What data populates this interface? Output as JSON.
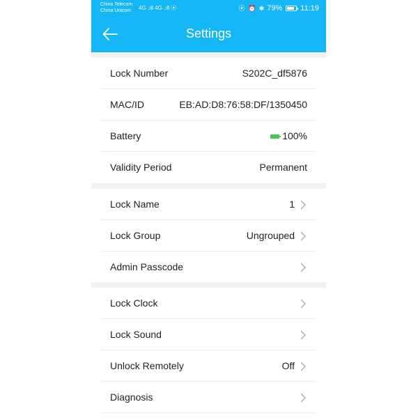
{
  "statusbar": {
    "carrier1": "China Telecom",
    "carrier2": "China Unicom",
    "signal_text": "4G .ıll 4G .ıll ⦿",
    "icons_text": "⦿ ⏰ ✱",
    "battery_percent": "79%",
    "time": "11:19"
  },
  "header": {
    "title": "Settings",
    "back_icon": "arrow-left-icon",
    "bg_color": "#14b6f5"
  },
  "info": [
    {
      "label": "Lock Number",
      "value": "S202C_df5876"
    },
    {
      "label": "MAC/ID",
      "value": "EB:AD:D8:76:58:DF/1350450"
    },
    {
      "label": "Battery",
      "value": "100%"
    },
    {
      "label": "Validity Period",
      "value": "Permanent"
    }
  ],
  "settings_a": [
    {
      "label": "Lock Name",
      "value": "1"
    },
    {
      "label": "Lock Group",
      "value": "Ungrouped"
    },
    {
      "label": "Admin Passcode",
      "value": ""
    }
  ],
  "settings_b": [
    {
      "label": "Lock Clock",
      "value": ""
    },
    {
      "label": "Lock Sound",
      "value": ""
    },
    {
      "label": "Unlock Remotely",
      "value": "Off"
    },
    {
      "label": "Diagnosis",
      "value": ""
    }
  ],
  "battery_level_color": "#3ecb50"
}
